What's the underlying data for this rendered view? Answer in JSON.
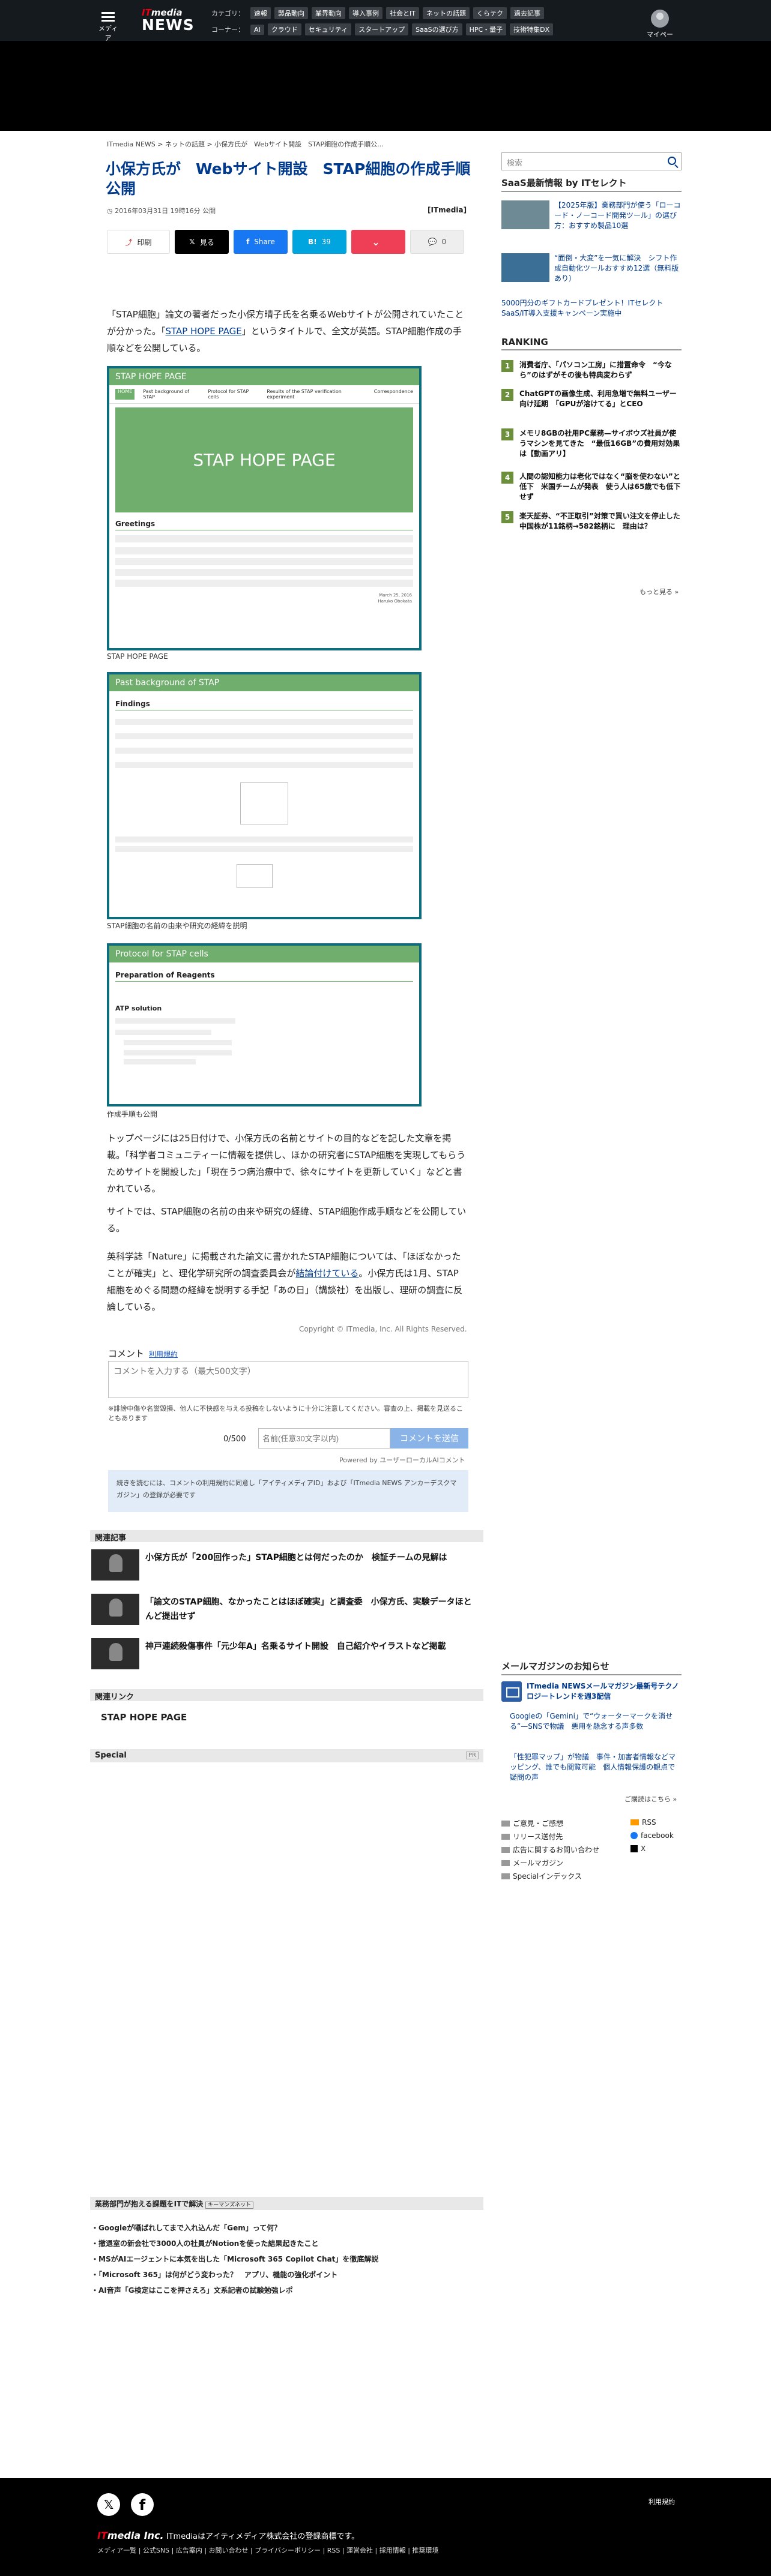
{
  "header": {
    "menu_label": "メディア",
    "logo_it": "IT",
    "logo_media": "media",
    "logo_news": "NEWS",
    "row1_heading": "カテゴリ：",
    "row1": [
      "速報",
      "製品動向",
      "業界動向",
      "導入事例",
      "社会とIT",
      "ネットの話題",
      "くらテク",
      "過去記事"
    ],
    "row2_heading": "コーナー：",
    "row2": [
      "AI",
      "クラウド",
      "セキュリティ",
      "スタートアップ",
      "SaaSの選び方",
      "HPC・量子",
      "技術特集DX"
    ],
    "mypage_label": "マイページ"
  },
  "breadcrumb": "ITmedia NEWS > ネットの話題 > 小保方氏が　Webサイト開設　STAP細胞の作成手順公...",
  "article": {
    "title": "小保方氏が　Webサイト開設　STAP細胞の作成手順公開",
    "date": "2016年03月31日 19時16分 公開",
    "source": "[ITmedia]",
    "share": {
      "print": "印刷",
      "x": "見る",
      "facebook": "Share",
      "hatena": "39",
      "pocket": "",
      "comment": "0"
    },
    "p1_a": "「STAP細胞」論文の著者だった小保方晴子氏を名乗るWebサイトが公開されていたことが分かった。「",
    "p1_link": "STAP HOPE PAGE",
    "p1_b": "」というタイトルで、全文が英語。STAP細胞作成の手順などを公開している。",
    "fig1": {
      "header": "STAP HOPE PAGE",
      "tabs": [
        "HOME",
        "Past background of STAP",
        "Protocol for STAP cells",
        "Results of the STAP verification experiment",
        "Correspondence"
      ],
      "banner": "STAP HOPE PAGE",
      "section": "Greetings",
      "sign_date": "March 25, 2016",
      "sign_name": "Haruko Obokata",
      "caption": "STAP HOPE PAGE"
    },
    "fig2": {
      "header": "Past background of STAP",
      "section": "Findings",
      "caption": "STAP細胞の名前の由来や研究の経緯を説明"
    },
    "fig3": {
      "header": "Protocol for STAP cells",
      "section": "Preparation of Reagents",
      "sub": "ATP solution",
      "caption": "作成手順も公開"
    },
    "p2": "トップページには25日付けで、小保方氏の名前とサイトの目的などを記した文章を掲載。「科学者コミュニティーに情報を提供し、ほかの研究者にSTAP細胞を実現してもらうためサイトを開設した」「現在うつ病治療中で、徐々にサイトを更新していく」などと書かれている。",
    "p3": "サイトでは、STAP細胞の名前の由来や研究の経緯、STAP細胞作成手順などを公開している。",
    "p4_a": "英科学誌「Nature」に掲載された論文に書かれたSTAP細胞については、「ほぼなかったことが確実」と、理化学研究所の調査委員会が",
    "p4_link": "結論付けている",
    "p4_b": "。小保方氏は1月、STAP細胞をめぐる問題の経緯を説明する手記「あの日」（講談社）を出版し、理研の調査に反論している。",
    "copyright": "Copyright © ITmedia, Inc. All Rights Reserved."
  },
  "comments": {
    "heading": "コメント",
    "terms_link": "利用規約",
    "placeholder": "コメントを入力する（最大500文字）",
    "note": "※誹謗中傷や名誉毀損、他人に不快感を与える投稿をしないように十分に注意してください。審査の上、掲載を見送ることもあります",
    "count": "0/500",
    "name_placeholder": "名前(任意30文字以内)",
    "submit": "コメントを送信",
    "powered": "Powered by ユーザーローカルAIコメント",
    "notice": "続きを読むには、コメントの利用規約に同意し「アイティメディアID」および「ITmedia NEWS アンカーデスクマガジン」の登録が必要です"
  },
  "related": {
    "heading": "関連記事",
    "items": [
      "小保方氏が「200回作った」STAP細胞とは何だったのか　検証チームの見解は",
      "「論文のSTAP細胞、なかったことはほぼ確実」と調査委　小保方氏、実験データほとんど提出せず",
      "神戸連続殺傷事件「元少年A」名乗るサイト開設　自己紹介やイラストなど掲載"
    ]
  },
  "related_links": {
    "heading": "関連リンク",
    "item": "STAP HOPE PAGE"
  },
  "special": {
    "heading": "Special",
    "badge": "PR"
  },
  "pr_block": {
    "heading": "業務部門が抱える課題をITで解決",
    "badge": "キーマンズネット",
    "items": [
      "Googleが囁ばれしてまで入れ込んだ「Gem」って何？",
      "撤退室の新会社で3000人の社員がNotionを使った結果起きたこと",
      "MSがAIエージェントに本気を出した「Microsoft 365 Copilot Chat」を徹底解説",
      "「Microsoft 365」は何がどう変わった？　アプリ、機能の強化ポイント",
      "AI音声「G検定はここを押さえろ」文系記者の試験勉強レポ"
    ]
  },
  "sidebar": {
    "search_placeholder": "検索",
    "saas_heading": "SaaS最新情報 by ITセレクト",
    "saas_items": [
      "【2025年版】業務部門が使う「ローコード・ノーコード開発ツール」の選び方：おすすめ製品10選",
      "“面倒・大変”を一気に解決　シフト作成自動化ツールおすすめ12選（無料版あり）"
    ],
    "promo": "5000円分のギフトカードプレゼント！ITセレクトSaaS/IT導入支援キャンペーン実施中",
    "ranking_heading": "RANKING",
    "ranking": [
      "消費者庁、「パソコン工房」に措置命令　“今なら”のはずがその後も特典変わらず",
      "ChatGPTの画像生成、利用急増で無料ユーザー向け延期　「GPUが溶けてる」とCEO",
      "メモリ8GBの社用PC業務—サイボウズ社員が使うマシンを見てきた　“最低16GB”の費用対効果は【動画アリ】",
      "人間の認知能力は老化ではなく“脳を使わない”と低下　米国チームが発表　使う人は65歳でも低下せず",
      "楽天証券、“不正取引”対策で買い注文を停止した中国株が11銘柄→582銘柄に　理由は？"
    ],
    "more": "もっと見る »",
    "mm_heading": "メールマガジンのお知らせ",
    "mm_title": "ITmedia NEWSメールマガジン最新号テクノロジートレンドを週3配信",
    "mm_items": [
      "Googleの「Gemini」で“ウォーターマークを消せる”—SNSで物議　悪用を懸念する声多数",
      "「性犯罪マップ」が物議　事件・加害者情報などマッピング、誰でも閲覧可能　個人情報保護の観点で疑問の声"
    ],
    "mm_more": "ご購読はこちら »",
    "links": [
      "ご意見・ご感想",
      "RSS",
      "リリース送付先",
      "facebook",
      "広告に関するお問い合わせ",
      "X",
      "メールマガジン",
      "Specialインデックス"
    ]
  },
  "footer": {
    "terms": "利用規約",
    "company_logo_it": "IT",
    "company_logo": "media Inc.",
    "company_text": "ITmediaはアイティメディア株式会社の登録商標です。",
    "links": "メディア一覧 | 公式SNS | 広告案内 | お問い合わせ | プライバシーポリシー | RSS | 運営会社 | 採用情報 | 推奨環境"
  }
}
